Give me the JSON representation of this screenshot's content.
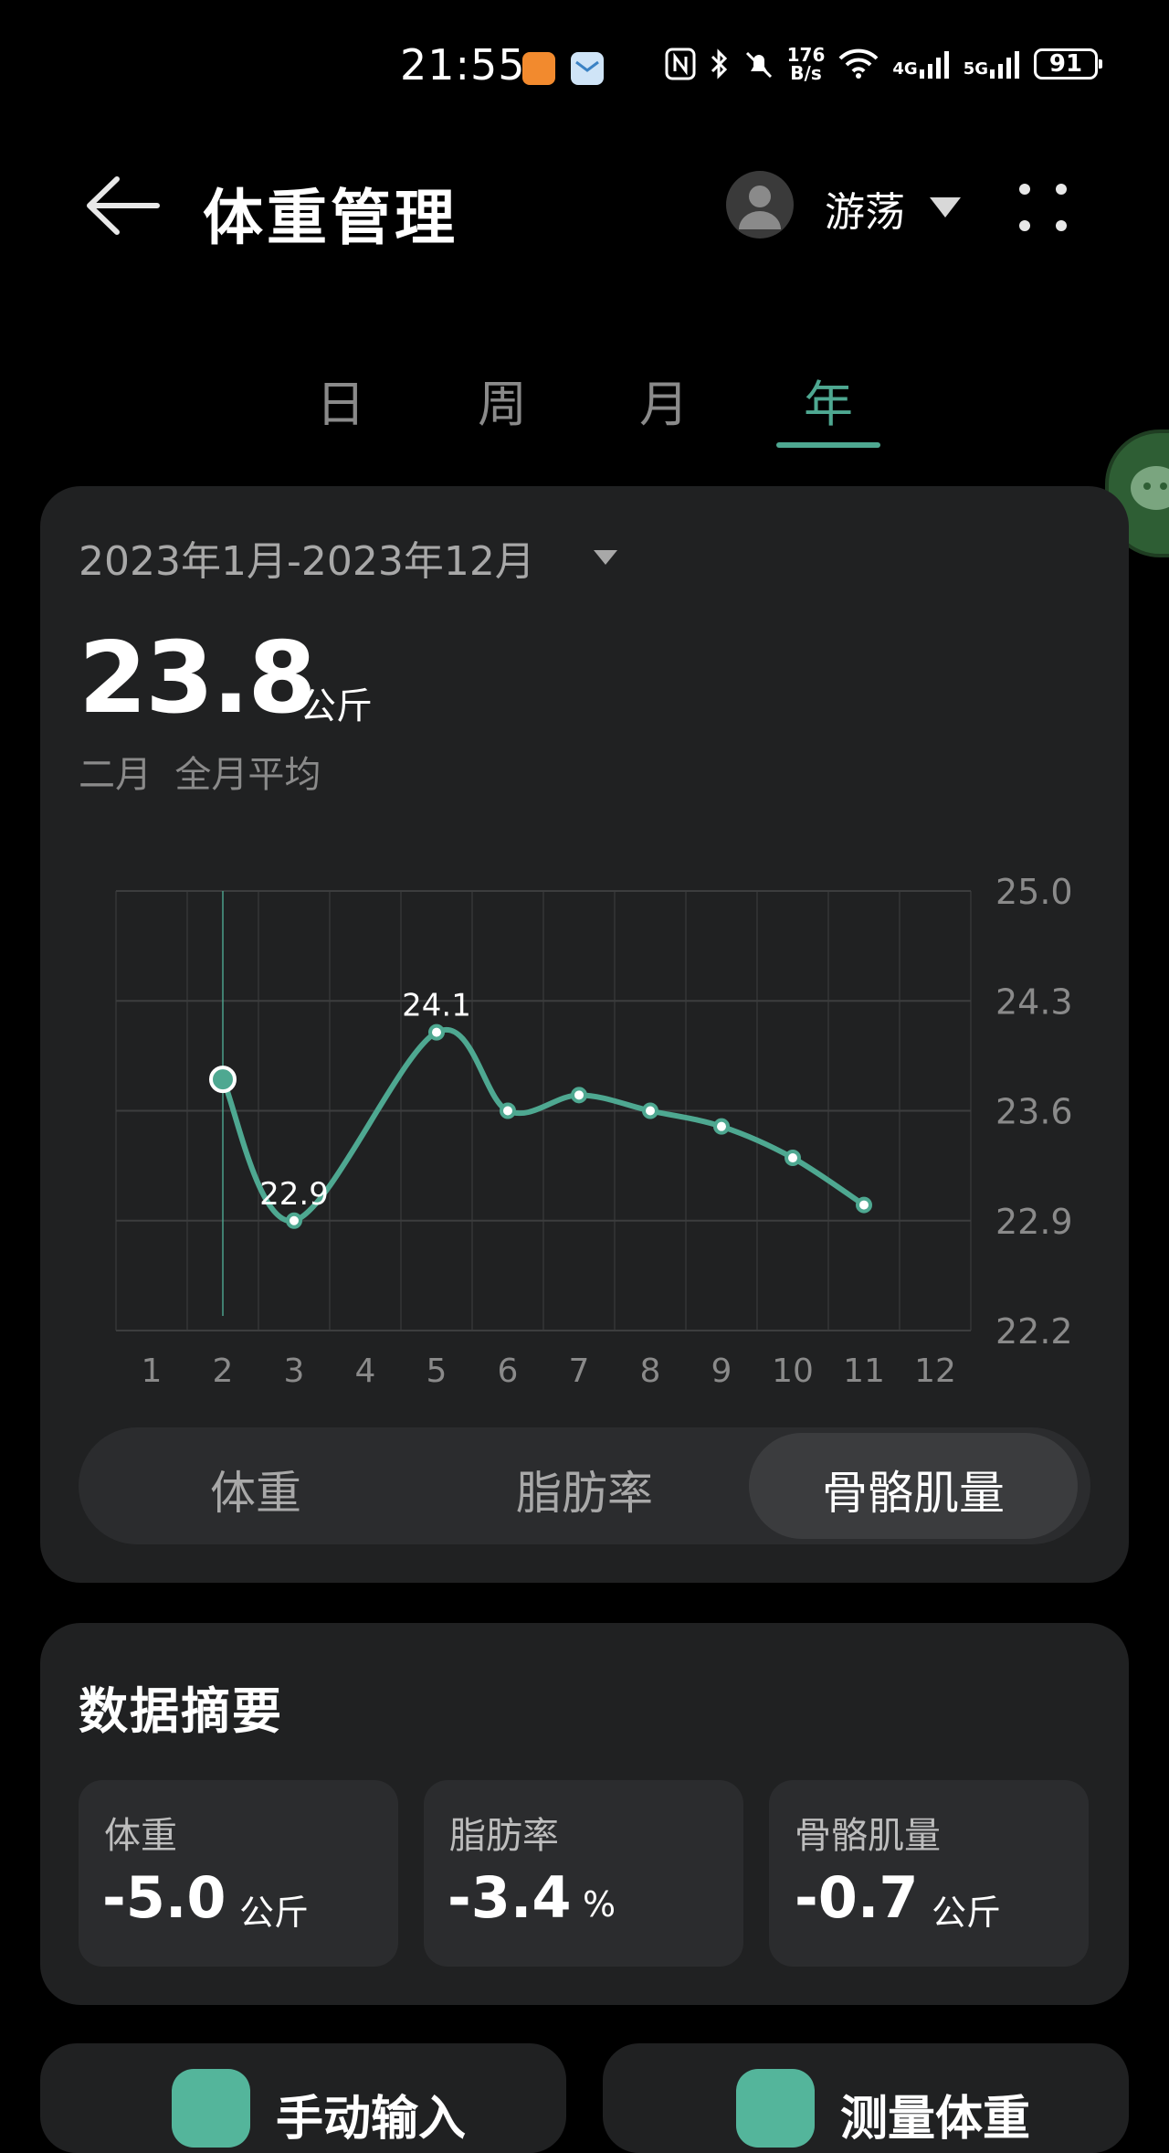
{
  "status_bar": {
    "time": "21:55",
    "net_speed_value": "176",
    "net_speed_unit": "B/s",
    "net_4g": "4G",
    "net_5g": "5G",
    "battery": "91"
  },
  "header": {
    "title": "体重管理",
    "user_name": "游荡"
  },
  "period_tabs": [
    {
      "label": "日",
      "active": false
    },
    {
      "label": "周",
      "active": false
    },
    {
      "label": "月",
      "active": false
    },
    {
      "label": "年",
      "active": true
    }
  ],
  "summary_header": {
    "date_range": "2023年1月-2023年12月",
    "value": "23.8",
    "unit": "公斤",
    "sub_label": "二月  全月平均"
  },
  "chart_data": {
    "type": "line",
    "x": [
      1,
      2,
      3,
      4,
      5,
      6,
      7,
      8,
      9,
      10,
      11,
      12
    ],
    "x_tick_labels": [
      "1",
      "2",
      "3",
      "4",
      "5",
      "6",
      "7",
      "8",
      "9",
      "10",
      "11",
      "12"
    ],
    "series": [
      {
        "values": [
          null,
          23.8,
          22.9,
          null,
          24.1,
          23.6,
          23.7,
          23.6,
          23.5,
          23.3,
          23.0,
          null
        ]
      }
    ],
    "y_tick_labels": [
      "25.0",
      "24.3",
      "23.6",
      "22.9",
      "22.2"
    ],
    "ylim": [
      22.2,
      25.0
    ],
    "annotations": [
      {
        "x": 5,
        "label": "24.1"
      },
      {
        "x": 3,
        "label": "22.9"
      }
    ],
    "selected_x": 2,
    "grid": true,
    "line_color": "#4ea891"
  },
  "metric_switch": [
    {
      "label": "体重",
      "active": false
    },
    {
      "label": "脂肪率",
      "active": false
    },
    {
      "label": "骨骼肌量",
      "active": true
    }
  ],
  "data_summary": {
    "title": "数据摘要",
    "tiles": [
      {
        "label": "体重",
        "value": "-5.0",
        "unit": "公斤"
      },
      {
        "label": "脂肪率",
        "value": "-3.4",
        "unit": "%"
      },
      {
        "label": "骨骼肌量",
        "value": "-0.7",
        "unit": "公斤"
      }
    ]
  },
  "bottom_actions": [
    {
      "label": "手动输入"
    },
    {
      "label": "测量体重"
    }
  ],
  "colors": {
    "accent": "#4ea891",
    "card": "#202122",
    "background": "#000000"
  }
}
